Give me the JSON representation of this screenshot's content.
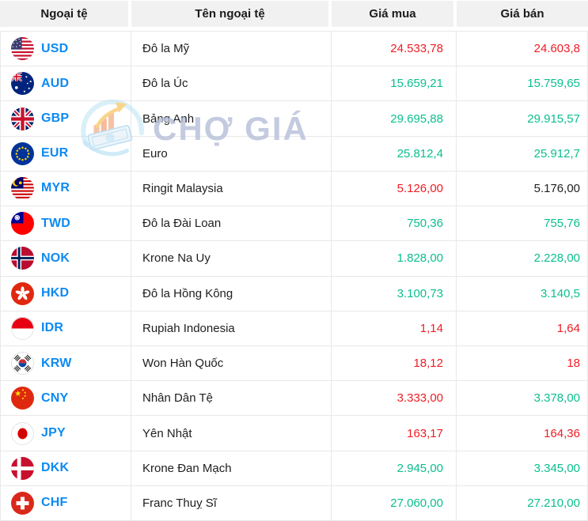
{
  "colors": {
    "up": "#0abf8e",
    "down": "#ee1d25",
    "neutral": "#1f1f1f",
    "code_blue": "#0d8af2",
    "header_bg": "#f1f1f1",
    "border": "#e8e8e8"
  },
  "watermark": {
    "text": "CHỢ GIÁ",
    "logo_icon": "choga-logo-icon"
  },
  "table": {
    "columns": [
      {
        "key": "code",
        "label": "Ngoại tệ"
      },
      {
        "key": "name",
        "label": "Tên ngoại tệ"
      },
      {
        "key": "buy",
        "label": "Giá mua"
      },
      {
        "key": "sell",
        "label": "Giá bán"
      }
    ],
    "rows": [
      {
        "code": "USD",
        "flag": "flag-usd",
        "name": "Đô la Mỹ",
        "buy": "24.533,78",
        "buy_trend": "down",
        "sell": "24.603,8",
        "sell_trend": "down"
      },
      {
        "code": "AUD",
        "flag": "flag-aud",
        "name": "Đô la Úc",
        "buy": "15.659,21",
        "buy_trend": "up",
        "sell": "15.759,65",
        "sell_trend": "up"
      },
      {
        "code": "GBP",
        "flag": "flag-gbp",
        "name": "Bảng Anh",
        "buy": "29.695,88",
        "buy_trend": "up",
        "sell": "29.915,57",
        "sell_trend": "up"
      },
      {
        "code": "EUR",
        "flag": "flag-eur",
        "name": "Euro",
        "buy": "25.812,4",
        "buy_trend": "up",
        "sell": "25.912,7",
        "sell_trend": "up"
      },
      {
        "code": "MYR",
        "flag": "flag-myr",
        "name": "Ringit Malaysia",
        "buy": "5.126,00",
        "buy_trend": "down",
        "sell": "5.176,00",
        "sell_trend": "neutral"
      },
      {
        "code": "TWD",
        "flag": "flag-twd",
        "name": "Đô la Đài Loan",
        "buy": "750,36",
        "buy_trend": "up",
        "sell": "755,76",
        "sell_trend": "up"
      },
      {
        "code": "NOK",
        "flag": "flag-nok",
        "name": "Krone Na Uy",
        "buy": "1.828,00",
        "buy_trend": "up",
        "sell": "2.228,00",
        "sell_trend": "up"
      },
      {
        "code": "HKD",
        "flag": "flag-hkd",
        "name": "Đô la Hồng Kông",
        "buy": "3.100,73",
        "buy_trend": "up",
        "sell": "3.140,5",
        "sell_trend": "up"
      },
      {
        "code": "IDR",
        "flag": "flag-idr",
        "name": "Rupiah Indonesia",
        "buy": "1,14",
        "buy_trend": "down",
        "sell": "1,64",
        "sell_trend": "down"
      },
      {
        "code": "KRW",
        "flag": "flag-krw",
        "name": "Won Hàn Quốc",
        "buy": "18,12",
        "buy_trend": "down",
        "sell": "18",
        "sell_trend": "down"
      },
      {
        "code": "CNY",
        "flag": "flag-cny",
        "name": "Nhân Dân Tệ",
        "buy": "3.333,00",
        "buy_trend": "down",
        "sell": "3.378,00",
        "sell_trend": "up"
      },
      {
        "code": "JPY",
        "flag": "flag-jpy",
        "name": "Yên Nhật",
        "buy": "163,17",
        "buy_trend": "down",
        "sell": "164,36",
        "sell_trend": "down"
      },
      {
        "code": "DKK",
        "flag": "flag-dkk",
        "name": "Krone Đan Mạch",
        "buy": "2.945,00",
        "buy_trend": "up",
        "sell": "3.345,00",
        "sell_trend": "up"
      },
      {
        "code": "CHF",
        "flag": "flag-chf",
        "name": "Franc Thuỵ Sĩ",
        "buy": "27.060,00",
        "buy_trend": "up",
        "sell": "27.210,00",
        "sell_trend": "up"
      }
    ]
  }
}
